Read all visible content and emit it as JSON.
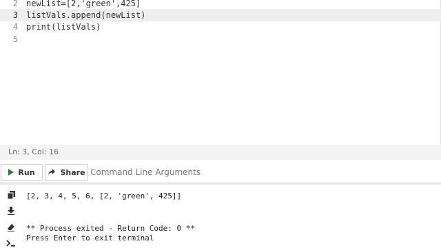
{
  "editor": {
    "lines": [
      {
        "number": "2",
        "text": "newList=[2,'green',425]"
      },
      {
        "number": "3",
        "text": "listVals.append(newList)"
      },
      {
        "number": "4",
        "text": "print(listVals)"
      },
      {
        "number": "5",
        "text": ""
      }
    ],
    "active_line": "3"
  },
  "statusbar": {
    "position": "Ln: 3, Col: 16"
  },
  "toolbar": {
    "run_label": "Run",
    "share_label": "Share",
    "args_placeholder": "Command Line Arguments",
    "args_value": ""
  },
  "icons": {
    "run": "play-icon",
    "share": "share-icon",
    "copy": "copy-icon",
    "download": "download-icon",
    "clear": "eraser-icon",
    "terminal": "terminal-icon"
  },
  "colors": {
    "run_accent": "#2f7d32",
    "active_line_bg": "#eeeeee"
  },
  "terminal": {
    "lines": [
      "[2, 3, 4, 5, 6, [2, 'green', 425]]",
      "",
      "",
      "** Process exited - Return Code: 0 **",
      "Press Enter to exit terminal"
    ]
  }
}
